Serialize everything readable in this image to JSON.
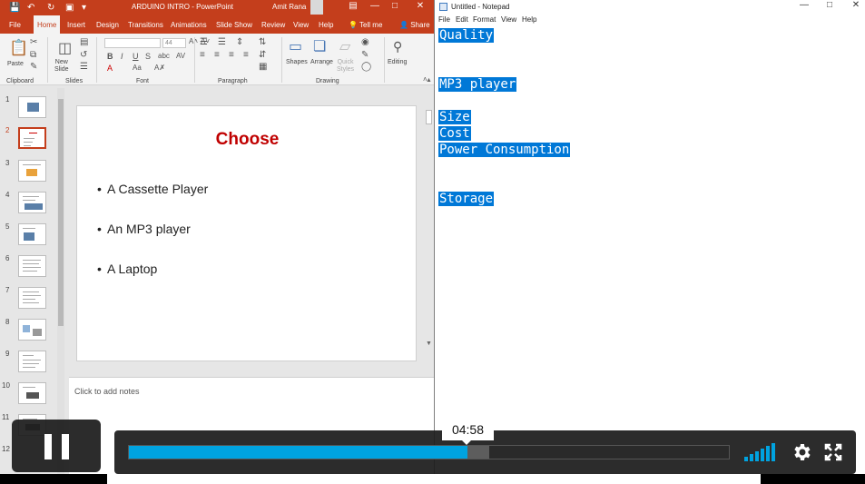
{
  "ppt": {
    "title": "ARDUINO INTRO  -  PowerPoint",
    "user": "Amit Rana",
    "tabs": [
      "File",
      "Home",
      "Insert",
      "Design",
      "Transitions",
      "Animations",
      "Slide Show",
      "Review",
      "View",
      "Help",
      "Tell me",
      "Share"
    ],
    "font_size_value": "44",
    "ribbon": {
      "paste": "Paste",
      "new_slide": "New\nSlide",
      "shapes": "Shapes",
      "arrange": "Arrange",
      "quick_styles": "Quick\nStyles",
      "editing": "Editing"
    },
    "groups": [
      "Clipboard",
      "Slides",
      "Font",
      "Paragraph",
      "Drawing"
    ],
    "thumb_numbers": [
      "1",
      "2",
      "3",
      "4",
      "5",
      "6",
      "7",
      "8",
      "9",
      "10",
      "11",
      "12"
    ],
    "slide": {
      "title": "Choose",
      "bullets": [
        "A Cassette Player",
        "An MP3 player",
        "A Laptop"
      ]
    },
    "notes_placeholder": "Click to add notes"
  },
  "notepad": {
    "title": "Untitled - Notepad",
    "menu": [
      "File",
      "Edit",
      "Format",
      "View",
      "Help"
    ],
    "lines": [
      "Quality",
      "",
      "",
      "MP3 player",
      "",
      "Size",
      "Cost",
      "Power Consumption",
      "",
      "",
      "Storage"
    ]
  },
  "player": {
    "time_tooltip": "04:58",
    "progress_fraction": 0.565,
    "buffered_fraction": 0.6
  },
  "colors": {
    "ppt_accent": "#c43e1c",
    "slide_title": "#c00000",
    "selection": "#0078d7",
    "player_accent": "#00a3e0"
  }
}
